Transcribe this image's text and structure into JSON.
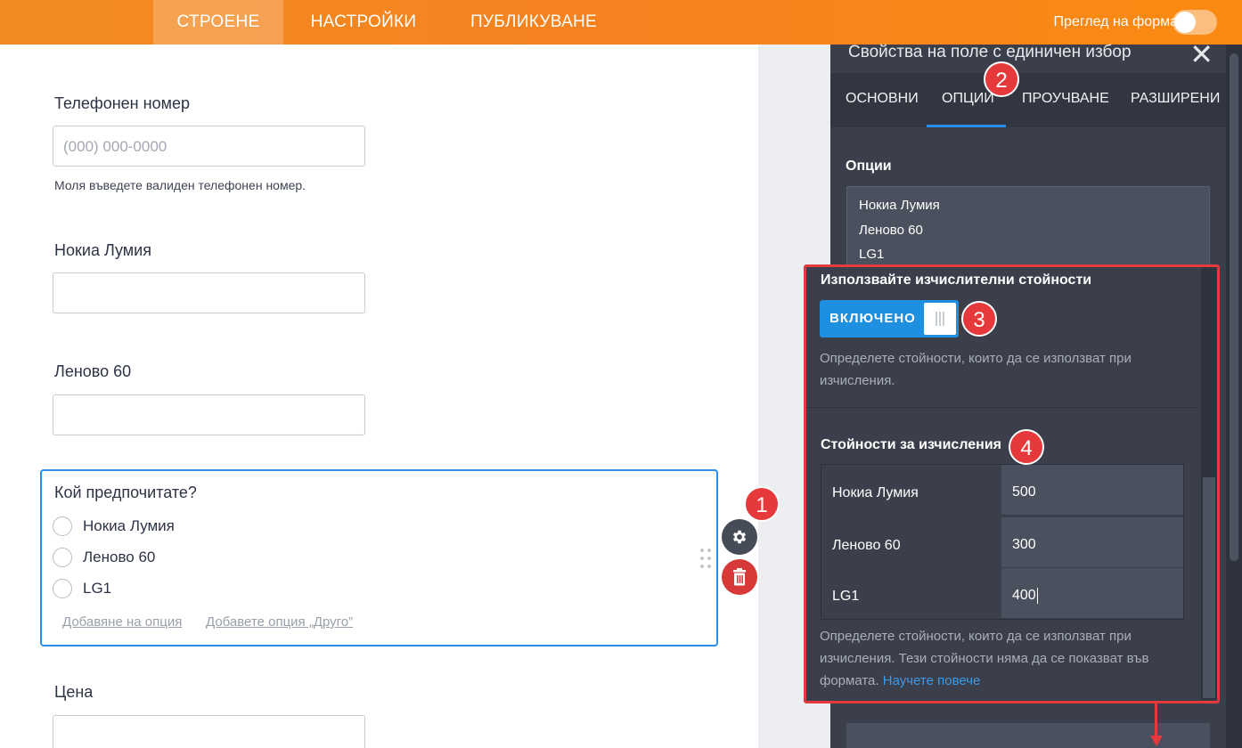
{
  "topbar": {
    "tabs": [
      {
        "label": "СТРОЕНЕ",
        "active": true
      },
      {
        "label": "НАСТРОЙКИ",
        "active": false
      },
      {
        "label": "ПУБЛИКУВАНЕ",
        "active": false
      }
    ],
    "preview_label": "Преглед на форма",
    "preview_enabled": false
  },
  "form": {
    "phone_label": "Телефонен номер",
    "phone_placeholder": "(000) 000-0000",
    "phone_hint": "Моля въведете валиден телефонен номер.",
    "field_nokia_label": "Нокиа Лумия",
    "field_lenovo_label": "Леново 60",
    "question_label": "Кой предпочитате?",
    "radio_options": [
      "Нокиа Лумия",
      "Леново 60",
      "LG1"
    ],
    "add_option_link": "Добавяне на опция",
    "add_other_link": "Добавете опция „Друго”",
    "price_label": "Цена"
  },
  "badges": [
    "1",
    "2",
    "3",
    "4"
  ],
  "panel": {
    "title": "Свойства на поле с единичен избор",
    "close_glyph": "✕",
    "tabs": [
      "ОСНОВНИ",
      "ОПЦИИ",
      "ПРОУЧВАНЕ",
      "РАЗШИРЕНИ"
    ],
    "active_tab": "ОПЦИИ",
    "options_heading": "Опции",
    "options_lines": [
      "Нокиа Лумия",
      "Леново 60",
      "LG1"
    ],
    "calc_title": "Използвайте изчислителни стойности",
    "calc_toggle_label": "ВКЛЮЧЕНО",
    "calc_desc_1": "Определете стойности, които да се използват при",
    "calc_desc_2": "изчисления.",
    "values_title": "Стойности за изчисления",
    "values": [
      {
        "option": "Нокиа Лумия",
        "value": "500"
      },
      {
        "option": "Леново 60",
        "value": "300"
      },
      {
        "option": "LG1",
        "value": "400"
      }
    ],
    "values_desc_1": "Определете стойности, които да се използват при",
    "values_desc_2": "изчисления. Тези стойности няма да се показват във",
    "values_desc_3": "формата.",
    "learn_more": "Научете повече"
  },
  "icons": {
    "gear": "gear-icon",
    "trash": "trash-icon",
    "close": "close-icon",
    "drag": "drag-handle-icon"
  },
  "colors": {
    "brand_orange": "#f5821f",
    "accent_blue": "#2b8ee6",
    "panel_bg": "#3a3f4b",
    "badge_red": "#e5393b"
  }
}
